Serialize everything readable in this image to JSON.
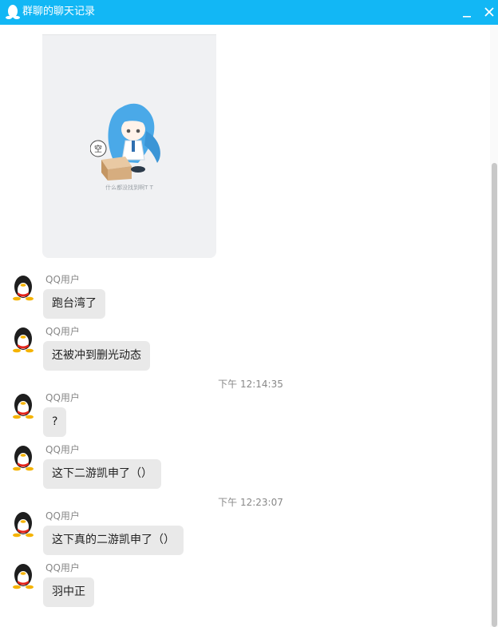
{
  "window": {
    "title": "群聊的聊天记录",
    "icons": {
      "app": "qq-penguin-icon",
      "minimize": "minimize-icon",
      "close": "close-icon"
    }
  },
  "image_message": {
    "caption": "什么都没找到啊T T",
    "badge_text": "空",
    "icon": "empty-box-mascot-illustration"
  },
  "messages": [
    {
      "sender": "QQ用户",
      "text": "跑台湾了"
    },
    {
      "sender": "QQ用户",
      "text": "还被冲到删光动态"
    },
    {
      "timestamp": "下午 12:14:35"
    },
    {
      "sender": "QQ用户",
      "text": "?"
    },
    {
      "sender": "QQ用户",
      "text": "这下二游凯申了（）"
    },
    {
      "timestamp": "下午 12:23:07"
    },
    {
      "sender": "QQ用户",
      "text": "这下真的二游凯申了（）"
    },
    {
      "sender": "QQ用户",
      "text": "羽中正"
    }
  ],
  "colors": {
    "titlebar": "#12b7f5",
    "bubble": "#e9e9e9",
    "meta_text": "#888888"
  }
}
